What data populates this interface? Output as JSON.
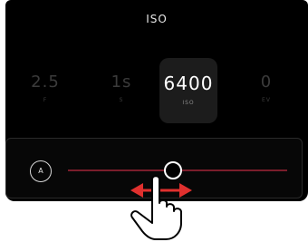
{
  "screen": {
    "title": "ISO"
  },
  "params": [
    {
      "value": "2.5",
      "label": "F"
    },
    {
      "value": "1s",
      "label": "S"
    },
    {
      "value": "6400",
      "label": "ISO"
    },
    {
      "value": "0",
      "label": "EV"
    }
  ],
  "slider": {
    "auto_label": "A",
    "accent_color": "#7a1d2b",
    "arrow_color": "#e0302e"
  },
  "gesture": {
    "icon": "hand-pointer-icon"
  }
}
